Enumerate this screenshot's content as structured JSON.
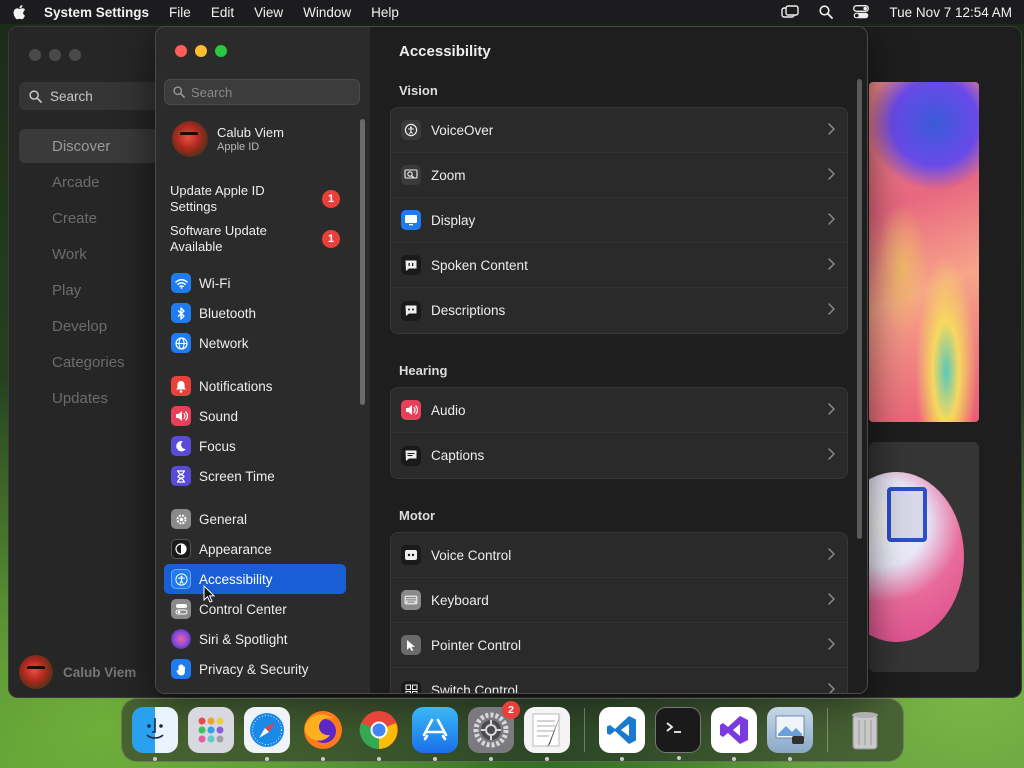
{
  "menubar": {
    "app_name": "System Settings",
    "items": [
      "File",
      "Edit",
      "View",
      "Window",
      "Help"
    ],
    "datetime": "Tue Nov 7  12:54 AM"
  },
  "background_app": {
    "search_label": "Search",
    "nav": [
      "Discover",
      "Arcade",
      "Create",
      "Work",
      "Play",
      "Develop",
      "Categories",
      "Updates"
    ],
    "active_nav": "Discover",
    "user_name": "Calub Viem"
  },
  "settings": {
    "sidebar": {
      "search_placeholder": "Search",
      "profile": {
        "name": "Calub Viem",
        "subtitle": "Apple ID"
      },
      "notices": [
        {
          "label": "Update Apple ID Settings",
          "badge": "1"
        },
        {
          "label": "Software Update Available",
          "badge": "1"
        }
      ],
      "groups": [
        [
          {
            "label": "Wi-Fi",
            "icon": "wifi-icon",
            "color": "#1f7cf0"
          },
          {
            "label": "Bluetooth",
            "icon": "bluetooth-icon",
            "color": "#1f7cf0"
          },
          {
            "label": "Network",
            "icon": "globe-icon",
            "color": "#1f7cf0"
          }
        ],
        [
          {
            "label": "Notifications",
            "icon": "bell-icon",
            "color": "#e8403a"
          },
          {
            "label": "Sound",
            "icon": "speaker-icon",
            "color": "#e8405a"
          },
          {
            "label": "Focus",
            "icon": "moon-icon",
            "color": "#5a4ad8"
          },
          {
            "label": "Screen Time",
            "icon": "hourglass-icon",
            "color": "#5a4ad8"
          }
        ],
        [
          {
            "label": "General",
            "icon": "gear-icon",
            "color": "#8a8a8a"
          },
          {
            "label": "Appearance",
            "icon": "appearance-icon",
            "color": "#1a1a1a"
          },
          {
            "label": "Accessibility",
            "icon": "accessibility-icon",
            "color": "#1f7cf0",
            "active": true
          },
          {
            "label": "Control Center",
            "icon": "toggles-icon",
            "color": "#8a8a8a"
          },
          {
            "label": "Siri & Spotlight",
            "icon": "siri-icon",
            "color": "#c04ac8"
          },
          {
            "label": "Privacy & Security",
            "icon": "hand-icon",
            "color": "#1f7cf0"
          }
        ]
      ]
    },
    "main": {
      "title": "Accessibility",
      "sections": [
        {
          "heading": "Vision",
          "rows": [
            {
              "label": "VoiceOver",
              "icon": "voiceover-icon"
            },
            {
              "label": "Zoom",
              "icon": "zoom-icon"
            },
            {
              "label": "Display",
              "icon": "display-icon"
            },
            {
              "label": "Spoken Content",
              "icon": "spoken-content-icon"
            },
            {
              "label": "Descriptions",
              "icon": "descriptions-icon"
            }
          ]
        },
        {
          "heading": "Hearing",
          "rows": [
            {
              "label": "Audio",
              "icon": "audio-icon"
            },
            {
              "label": "Captions",
              "icon": "captions-icon"
            }
          ]
        },
        {
          "heading": "Motor",
          "rows": [
            {
              "label": "Voice Control",
              "icon": "voice-control-icon"
            },
            {
              "label": "Keyboard",
              "icon": "keyboard-icon"
            },
            {
              "label": "Pointer Control",
              "icon": "pointer-control-icon"
            },
            {
              "label": "Switch Control",
              "icon": "switch-control-icon"
            }
          ]
        }
      ]
    }
  },
  "dock": {
    "apps": [
      "finder-icon",
      "launchpad-icon",
      "safari-icon",
      "firefox-icon",
      "chrome-icon",
      "app-store-icon",
      "system-settings-icon",
      "textedit-icon",
      "vscode-icon",
      "terminal-icon",
      "visual-studio-icon",
      "preview-icon",
      "trash-icon"
    ],
    "settings_badge": "2"
  }
}
